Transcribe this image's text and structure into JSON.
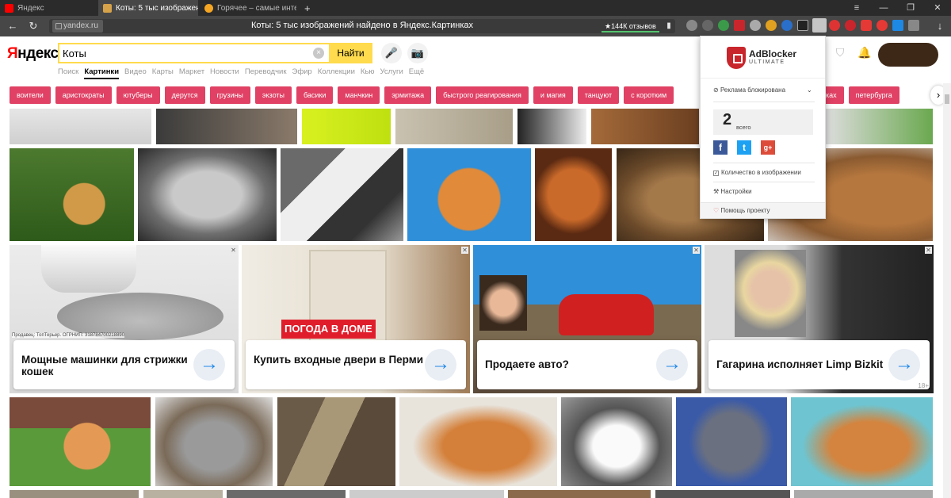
{
  "browser": {
    "tabs": [
      {
        "label": "Яндекс",
        "close": "×"
      },
      {
        "label": "Коты: 5 тыс изображен",
        "close": "×"
      },
      {
        "label": "Горячее – самые интересн",
        "close": "×"
      }
    ],
    "new_tab": "+",
    "window_controls": {
      "menu": "≡",
      "minimize": "—",
      "restore": "❐",
      "close": "✕"
    },
    "back": "←",
    "reload": "↻",
    "url_host": "yandex.ru",
    "page_title": "Коты: 5 тыс изображений найдено в Яндекс.Картинках",
    "reviews_badge": "★144К отзывов",
    "bookmark": "▮",
    "download": "↓"
  },
  "header": {
    "logo_first": "Я",
    "logo_rest": "ндекс",
    "search_value": "Коты",
    "clear": "×",
    "find_button": "Найти",
    "voice_icon": "🎤",
    "camera_icon": "📷",
    "services": [
      "Поиск",
      "Картинки",
      "Видео",
      "Карты",
      "Маркет",
      "Новости",
      "Переводчик",
      "Эфир",
      "Коллекции",
      "Кью",
      "Услуги",
      "Ещё"
    ],
    "active_service": "Картинки"
  },
  "tags": [
    "воители",
    "аристократы",
    "ютуберы",
    "дерутся",
    "грузины",
    "экзоты",
    "басики",
    "манчкин",
    "эрмитажа",
    "быстрого реагирования",
    "и магия",
    "танцуют",
    "с коротким",
    "в очках",
    "петербурга"
  ],
  "tags_next": "›",
  "ads": [
    {
      "title": "Мощные машинки для стрижки кошек",
      "go": "→",
      "close": "✕"
    },
    {
      "title": "Купить входные двери в Перми",
      "go": "→",
      "close": "✕",
      "banner": "ПОГОДА В ДОМЕ"
    },
    {
      "title": "Продаете авто?",
      "go": "→",
      "close": "✕"
    },
    {
      "title": "Гагарина исполняет Limp Bizkit",
      "go": "→",
      "close": "✕",
      "age": "18+"
    }
  ],
  "ad_seller": "Продавец: ТопТерьер. ОГРНИП: 318784700218890",
  "adblocker": {
    "brand": "AdBlocker",
    "brand_sub": "ULTIMATE",
    "status": "Реклама блокирована",
    "count": "2",
    "count_label": "всего",
    "social": [
      "f",
      "t",
      "g+"
    ],
    "option_count": "Количество в изображении",
    "settings": "Настройки",
    "help": "Помощь проекту",
    "colors": {
      "brand_red": "#c8262c",
      "facebook": "#3b5998",
      "twitter": "#1da1f2",
      "gplus": "#dd4b39"
    }
  },
  "colors": {
    "search_yellow": "#ffdb4d",
    "tag_pink": "#e04164",
    "chrome_dark": "#2b2b2b"
  }
}
